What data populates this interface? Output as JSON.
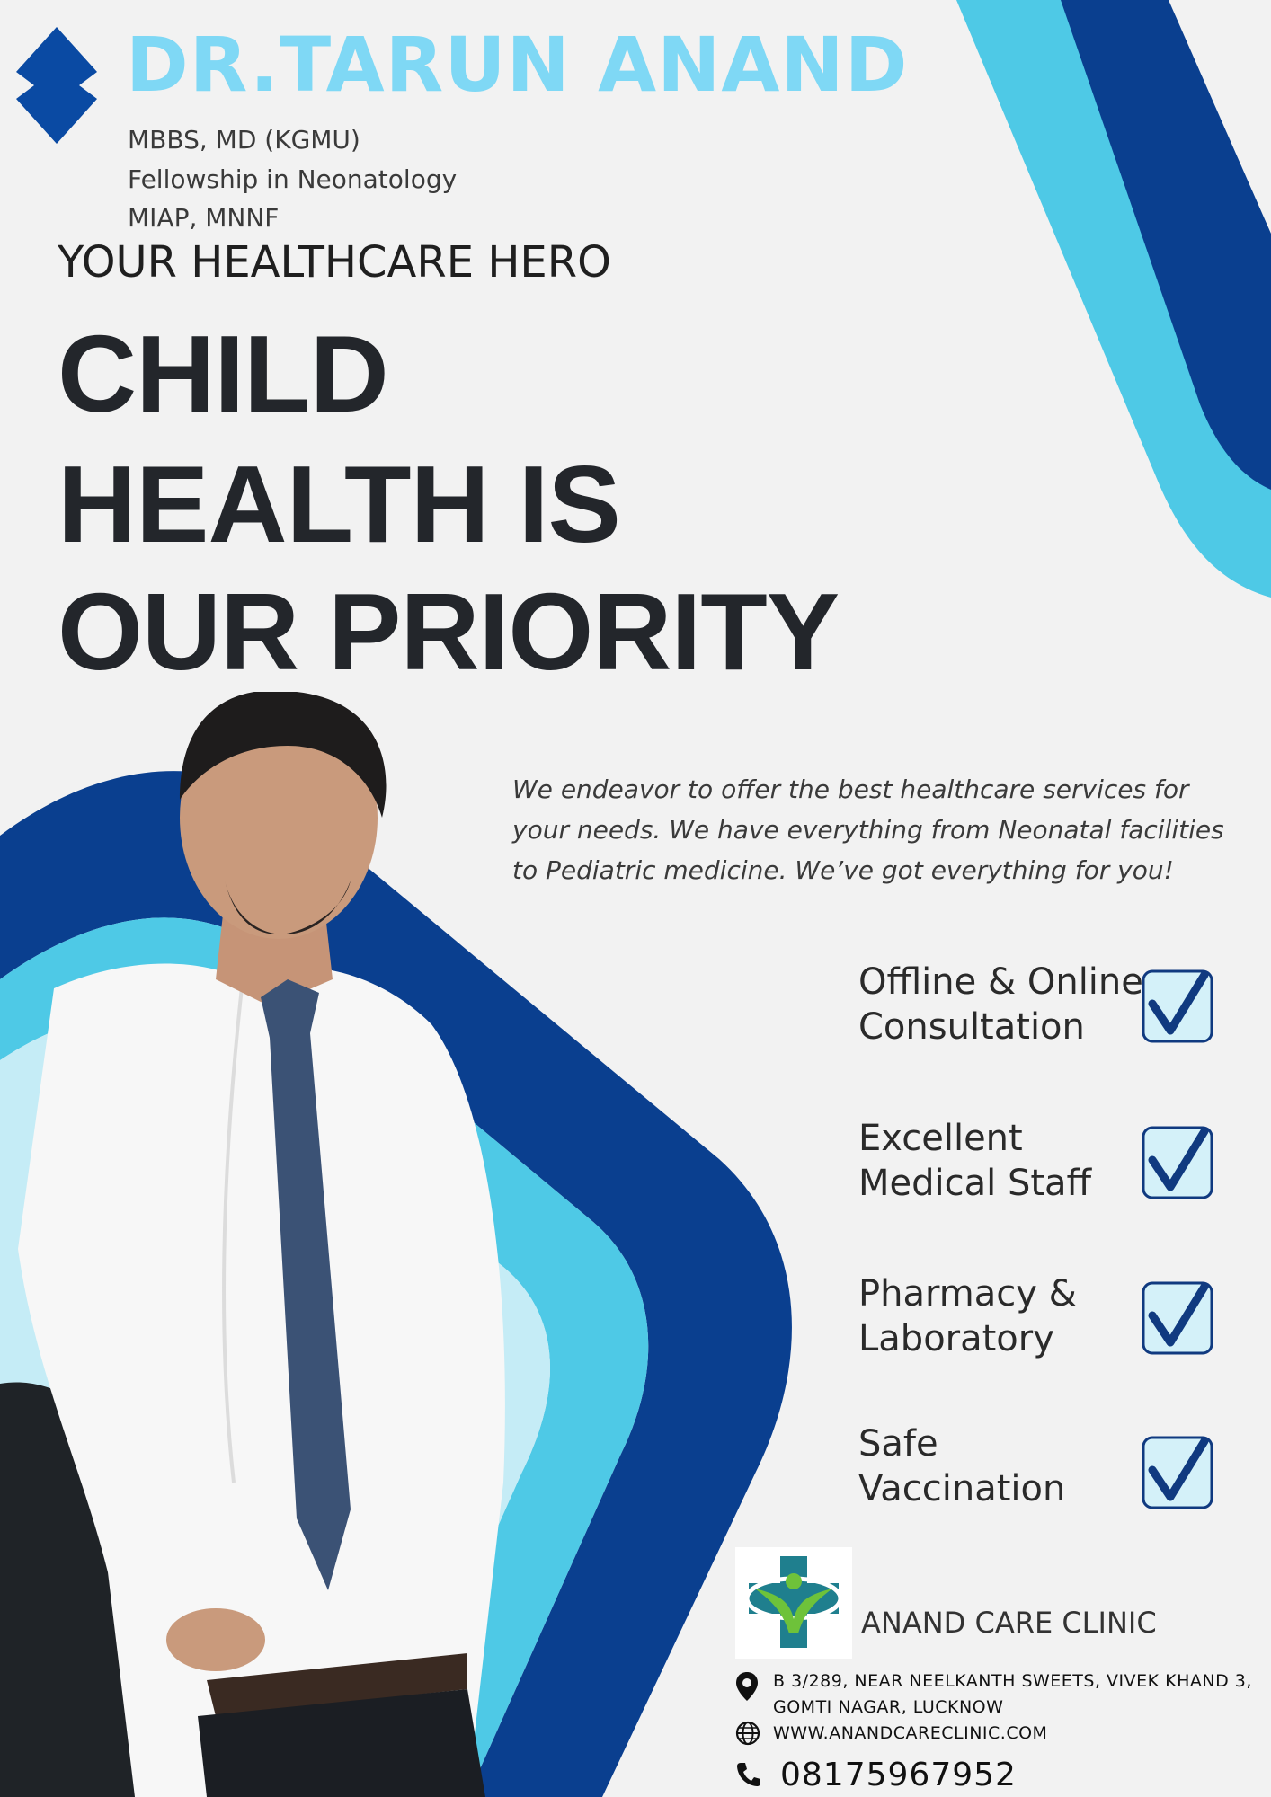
{
  "header": {
    "doctor_name": "DR.TARUN ANAND",
    "credentials": [
      "MBBS, MD (KGMU)",
      "Fellowship in Neonatology",
      "MIAP, MNNF"
    ],
    "tagline": "YOUR HEALTHCARE HERO"
  },
  "headline": {
    "lines": [
      "CHILD",
      "HEALTH IS",
      "OUR PRIORITY"
    ]
  },
  "intro": {
    "lines": [
      "We endeavor to offer the best healthcare services for",
      "your needs. We have everything from Neonatal facilities",
      "to Pediatric medicine. We’ve got everything for you!"
    ]
  },
  "features": [
    {
      "line1": "Offline & Online",
      "line2": "Consultation",
      "checked": true
    },
    {
      "line1": "Excellent",
      "line2": "Medical Staff",
      "checked": true
    },
    {
      "line1": "Pharmacy &",
      "line2": "Laboratory",
      "checked": true
    },
    {
      "line1": "Safe",
      "line2": "Vaccination",
      "checked": true
    }
  ],
  "clinic": {
    "name": "ANAND CARE CLINIC",
    "address_line1": "B 3/289, NEAR NEELKANTH SWEETS, VIVEK KHAND 3,",
    "address_line2": "GOMTI NAGAR, LUCKNOW",
    "website": "WWW.ANANDCARECLINIC.COM",
    "phone": "08175967952"
  },
  "icons": {
    "brand_mark": "diamond-logo-icon",
    "check": "checkbox-checked-icon",
    "location": "map-pin-icon",
    "web": "globe-icon",
    "phone": "phone-icon",
    "clinic_logo": "medical-cross-person-logo"
  },
  "colors": {
    "background": "#f2f2f2",
    "light_blue": "#4ec9e6",
    "dark_blue": "#0a3f8f",
    "pale_blue": "#c5ecf6",
    "name_blue": "#7fd8f5",
    "headline": "#23262b",
    "check_box": "#d4f1f9",
    "check_mark": "#103a80",
    "logo_teal": "#1f7f8e",
    "logo_green": "#6ec23a"
  }
}
